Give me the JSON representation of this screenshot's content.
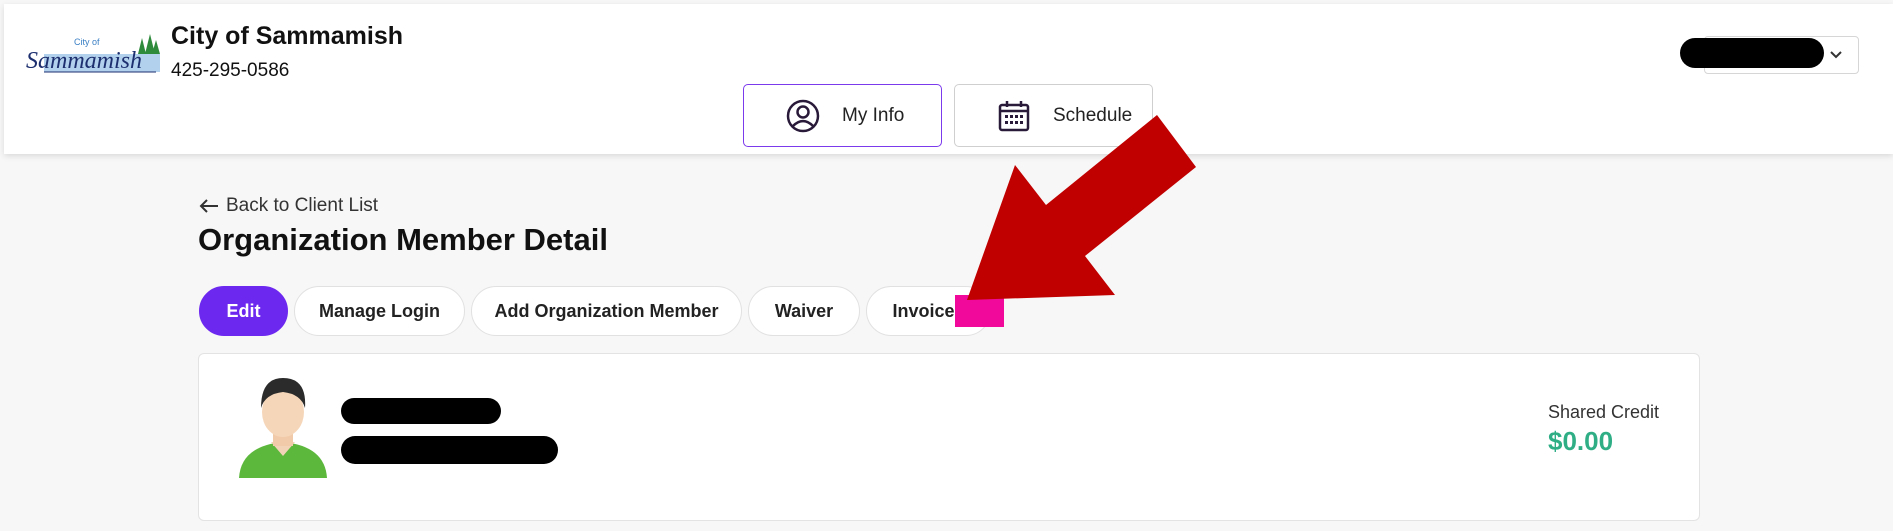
{
  "header": {
    "logo_text_top": "City of",
    "logo_text_main": "Sammamish",
    "org_name": "City of Sammamish",
    "phone": "425-295-0586",
    "nav": [
      {
        "label": "My Info",
        "icon": "user-circle-icon",
        "active": true
      },
      {
        "label": "Schedule",
        "icon": "calendar-icon",
        "active": false
      }
    ]
  },
  "page": {
    "back_link": "Back to Client List",
    "title": "Organization Member Detail",
    "actions": [
      {
        "label": "Edit",
        "primary": true
      },
      {
        "label": "Manage Login"
      },
      {
        "label": "Add Organization Member"
      },
      {
        "label": "Waiver"
      },
      {
        "label": "Invoices"
      }
    ]
  },
  "member": {
    "credit_label": "Shared Credit",
    "credit_value": "$0.00"
  },
  "colors": {
    "primary": "#6d28f0",
    "credit": "#2fae86",
    "annotation_arrow": "#c00000",
    "annotation_box": "#f0099a"
  }
}
